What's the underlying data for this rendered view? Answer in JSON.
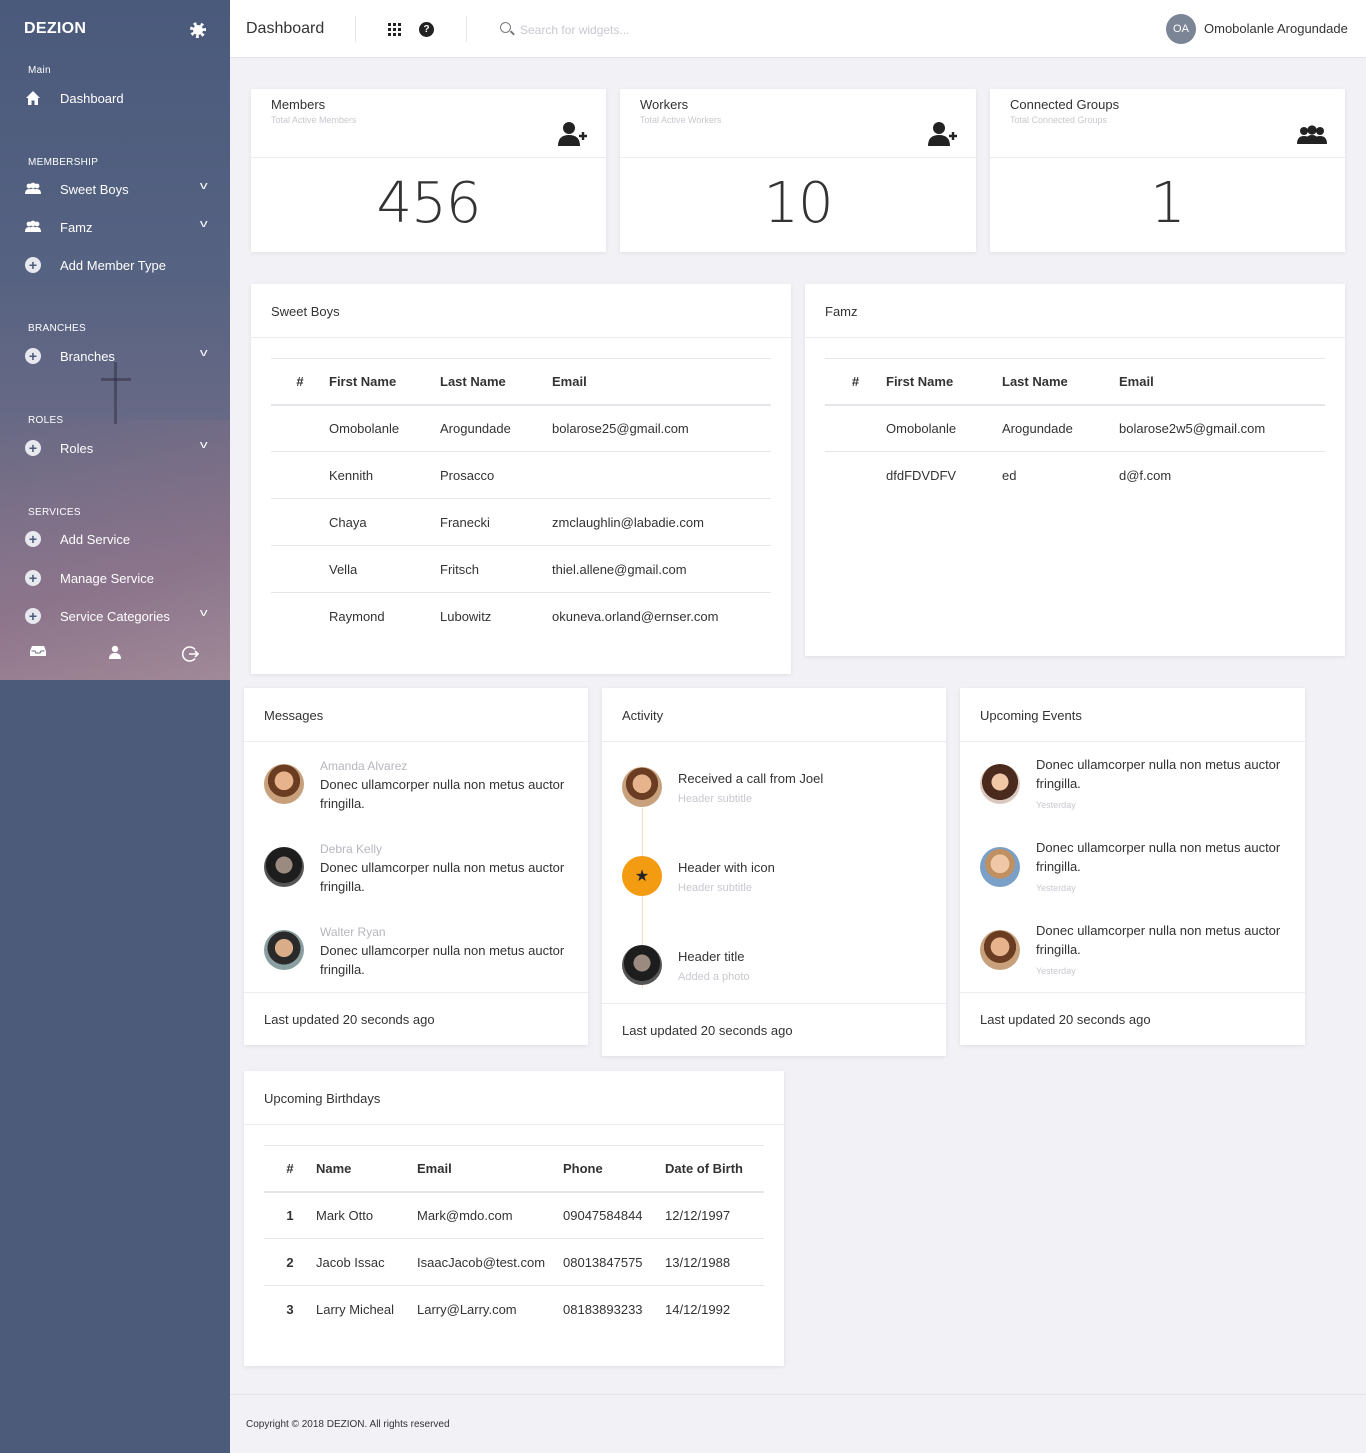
{
  "sidebar": {
    "brand": "DEZION",
    "sections": {
      "main": "Main",
      "membership": "MEMBERSHIP",
      "branches": "BRANCHES",
      "roles": "ROLES",
      "services": "SERVICES"
    },
    "items": {
      "dashboard": "Dashboard",
      "sweet_boys": "Sweet Boys",
      "famz": "Famz",
      "add_member_type": "Add Member Type",
      "branches": "Branches",
      "roles": "Roles",
      "add_service": "Add Service",
      "manage_service": "Manage Service",
      "service_categories": "Service Categories"
    }
  },
  "topbar": {
    "title": "Dashboard",
    "search_placeholder": "Search for widgets...",
    "avatar_initials": "OA",
    "user_name": "Omobolanle Arogundade",
    "help_glyph": "?"
  },
  "stats": [
    {
      "title": "Members",
      "subtitle": "Total Active Members",
      "value": "456",
      "icon": "add-user-icon"
    },
    {
      "title": "Workers",
      "subtitle": "Total Active Workers",
      "value": "10",
      "icon": "add-user-icon"
    },
    {
      "title": "Connected Groups",
      "subtitle": "Total Connected Groups",
      "value": "1",
      "icon": "users-group-icon"
    }
  ],
  "sweet_boys": {
    "title": "Sweet Boys",
    "headers": [
      "#",
      "First Name",
      "Last Name",
      "Email"
    ],
    "rows": [
      [
        "",
        "Omobolanle",
        "Arogundade",
        "bolarose25@gmail.com"
      ],
      [
        "",
        "Kennith",
        "Prosacco",
        ""
      ],
      [
        "",
        "Chaya",
        "Franecki",
        "zmclaughlin@labadie.com"
      ],
      [
        "",
        "Vella",
        "Fritsch",
        "thiel.allene@gmail.com"
      ],
      [
        "",
        "Raymond",
        "Lubowitz",
        "okuneva.orland@ernser.com"
      ]
    ]
  },
  "famz": {
    "title": "Famz",
    "headers": [
      "#",
      "First Name",
      "Last Name",
      "Email"
    ],
    "rows": [
      [
        "",
        "Omobolanle",
        "Arogundade",
        "bolarose2w5@gmail.com"
      ],
      [
        "",
        "dfdFDVDFV",
        "ed",
        "d@f.com"
      ]
    ]
  },
  "messages": {
    "title": "Messages",
    "items": [
      {
        "name": "Amanda Alvarez",
        "text": "Donec ullamcorper nulla non metus auctor fringilla."
      },
      {
        "name": "Debra Kelly",
        "text": "Donec ullamcorper nulla non metus auctor fringilla."
      },
      {
        "name": "Walter Ryan",
        "text": "Donec ullamcorper nulla non metus auctor fringilla."
      }
    ],
    "footer": "Last updated 20 seconds ago"
  },
  "activity": {
    "title": "Activity",
    "items": [
      {
        "title": "Received a call from Joel",
        "subtitle": "Header subtitle"
      },
      {
        "title": "Header with icon",
        "subtitle": "Header subtitle"
      },
      {
        "title": "Header title",
        "subtitle": "Added a photo"
      }
    ],
    "footer": "Last updated 20 seconds ago",
    "accent": "#f39c12"
  },
  "events": {
    "title": "Upcoming Events",
    "items": [
      {
        "text": "Donec ullamcorper nulla non metus auctor fringilla.",
        "time": "Yesterday"
      },
      {
        "text": "Donec ullamcorper nulla non metus auctor fringilla.",
        "time": "Yesterday"
      },
      {
        "text": "Donec ullamcorper nulla non metus auctor fringilla.",
        "time": "Yesterday"
      }
    ],
    "footer": "Last updated 20 seconds ago"
  },
  "birthdays": {
    "title": "Upcoming Birthdays",
    "headers": [
      "#",
      "Name",
      "Email",
      "Phone",
      "Date of Birth"
    ],
    "rows": [
      [
        "1",
        "Mark Otto",
        "Mark@mdo.com",
        "09047584844",
        "12/12/1997"
      ],
      [
        "2",
        "Jacob Issac",
        "IsaacJacob@test.com",
        "08013847575",
        "13/12/1988"
      ],
      [
        "3",
        "Larry Micheal",
        "Larry@Larry.com",
        "08183893233",
        "14/12/1992"
      ]
    ]
  },
  "footer": {
    "copyright": "Copyright © 2018 DEZION. All rights reserved"
  }
}
